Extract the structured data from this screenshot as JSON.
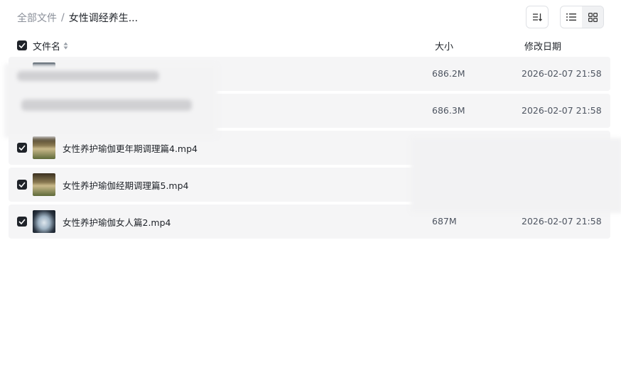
{
  "breadcrumb": {
    "root": "全部文件",
    "separator": "/",
    "current": "女性调经养生..."
  },
  "toolbar": {
    "sort_icon": "sort-descending-icon",
    "view_list_icon": "list-view-icon",
    "view_grid_icon": "grid-view-icon",
    "active_view": "list"
  },
  "table": {
    "headers": {
      "name": "文件名",
      "size": "大小",
      "date": "修改日期"
    },
    "select_all_checked": true,
    "rows": [
      {
        "name": "",
        "size": "686.2M",
        "date": "2026-02-07 21:58",
        "checked": true,
        "redacted": true
      },
      {
        "name": "",
        "size": "686.3M",
        "date": "2026-02-07 21:58",
        "checked": true,
        "redacted": true
      },
      {
        "name": "女性养护瑜伽更年期调理篇4.mp4",
        "size": "",
        "date": "",
        "checked": true
      },
      {
        "name": "女性养护瑜伽经期调理篇5.mp4",
        "size": "",
        "date": "",
        "checked": true
      },
      {
        "name": "女性养护瑜伽女人篇2.mp4",
        "size": "687M",
        "date": "2026-02-07 21:58",
        "checked": true
      }
    ]
  },
  "colors": {
    "row_bg": "#f5f5f6",
    "checkbox": "#1f2329",
    "muted_text": "#8a8f99"
  }
}
